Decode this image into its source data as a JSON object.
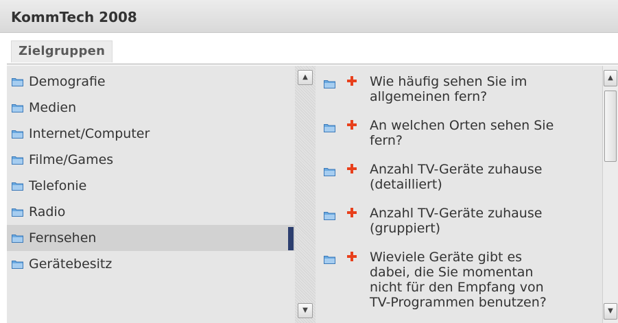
{
  "app": {
    "title": "KommTech 2008"
  },
  "tabs": [
    {
      "label": "Zielgruppen",
      "active": true
    }
  ],
  "categories": [
    {
      "label": "Demografie",
      "selected": false
    },
    {
      "label": "Medien",
      "selected": false
    },
    {
      "label": "Internet/Computer",
      "selected": false
    },
    {
      "label": "Filme/Games",
      "selected": false
    },
    {
      "label": "Telefonie",
      "selected": false
    },
    {
      "label": "Radio",
      "selected": false
    },
    {
      "label": "Fernsehen",
      "selected": true
    },
    {
      "label": "Gerätebesitz",
      "selected": false
    }
  ],
  "questions": [
    {
      "line1": "Wie häufig sehen Sie im",
      "line2": "allgemeinen fern?"
    },
    {
      "line1": "An welchen Orten sehen Sie",
      "line2": "fern?"
    },
    {
      "line1": "Anzahl TV-Geräte zuhause",
      "line2": "(detailliert)"
    },
    {
      "line1": "Anzahl TV-Geräte zuhause",
      "line2": "(gruppiert)"
    },
    {
      "line1": "Wieviele Geräte gibt es",
      "line2": "dabei, die Sie momentan",
      "line3": "nicht für den Empfang von",
      "line4": "TV-Programmen benutzen?"
    }
  ],
  "icons": {
    "folder": "folder-icon",
    "add": "plus-icon",
    "scroll_up": "arrow-up-icon",
    "scroll_down": "arrow-down-icon"
  },
  "colors": {
    "folder_blue": "#6aa9e0",
    "plus_red": "#e8401c",
    "selection_bar": "#2c3e6e"
  }
}
